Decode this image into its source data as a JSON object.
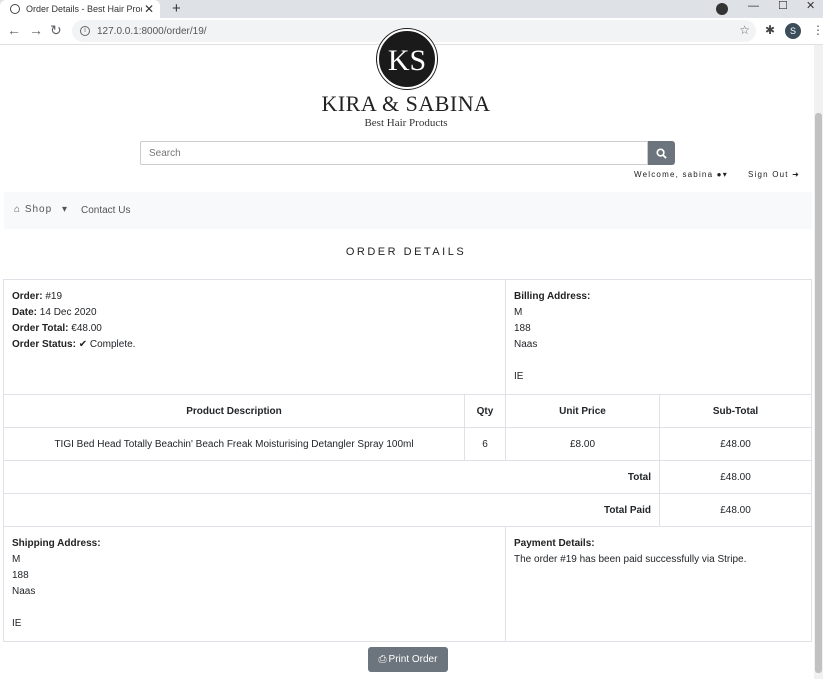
{
  "browser": {
    "tab_title": "Order Details - Best Hair Products",
    "tab_close": "✕",
    "new_tab": "+",
    "url": "127.0.0.1:8000/order/19/",
    "avatar_initial": "S"
  },
  "brand": {
    "logo_text": "KS",
    "name": "KIRA & SABINA",
    "tagline": "Best Hair Products"
  },
  "search": {
    "placeholder": "Search"
  },
  "account": {
    "welcome": "Welcome, sabina",
    "sign_out": "Sign Out"
  },
  "nav": {
    "shop": "Shop",
    "contact": "Contact Us"
  },
  "page_title": "ORDER DETAILS",
  "order": {
    "number_label": "Order:",
    "number": "#19",
    "date_label": "Date:",
    "date": "14 Dec 2020",
    "total_label": "Order Total:",
    "total": "€48.00",
    "status_label": "Order Status:",
    "status": "Complete."
  },
  "billing": {
    "label": "Billing Address:",
    "line1": "M",
    "line2": "188",
    "line3": "Naas",
    "line4": "",
    "line5": "IE"
  },
  "table": {
    "headers": [
      "Product Description",
      "Qty",
      "Unit Price",
      "Sub-Total"
    ],
    "rows": [
      {
        "description": "TIGI Bed Head Totally Beachin' Beach Freak Moisturising Detangler Spray 100ml",
        "qty": "6",
        "unit_price": "£8.00",
        "subtotal": "£48.00"
      }
    ],
    "total_label": "Total",
    "total": "£48.00",
    "paid_label": "Total Paid",
    "paid": "£48.00"
  },
  "shipping": {
    "label": "Shipping Address:",
    "line1": "M",
    "line2": "188",
    "line3": "Naas",
    "line4": "",
    "line5": "IE"
  },
  "payment": {
    "label": "Payment Details:",
    "text": "The order #19 has been paid successfully via Stripe."
  },
  "print_button": "Print Order"
}
